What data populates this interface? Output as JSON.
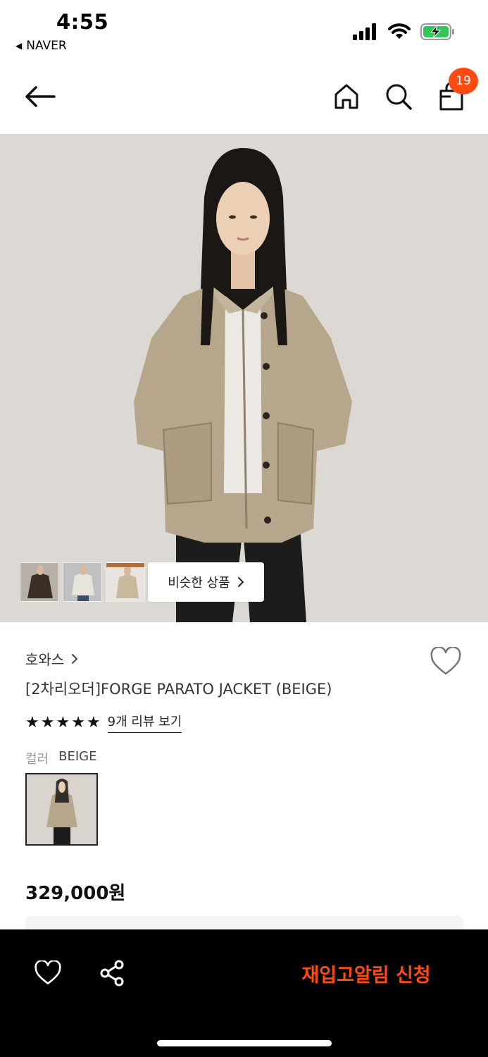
{
  "status_bar": {
    "time": "4:55",
    "back_app": "NAVER"
  },
  "nav": {
    "cart_count": "19"
  },
  "gallery": {
    "similar_label": "비슷한 상품",
    "thumbnail_count": 3
  },
  "product": {
    "brand": "호와스",
    "name": "[2차리오더]FORGE PARATO JACKET (BEIGE)",
    "rating": 5,
    "review_link": "9개 리뷰 보기",
    "color_label": "컬러",
    "color_value": "BEIGE",
    "price": "329,000원"
  },
  "bottom_bar": {
    "restock_label": "재입고알림 신청"
  },
  "colors": {
    "accent": "#ff4b12",
    "bottom_bar_bg": "#000000",
    "hero_bg": "#dcd8d3"
  }
}
